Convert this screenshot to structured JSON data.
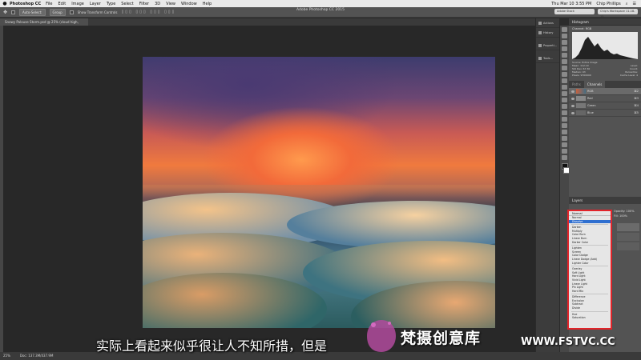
{
  "menubar": {
    "app_name": "Photoshop CC",
    "items": [
      "File",
      "Edit",
      "Image",
      "Layer",
      "Type",
      "Select",
      "Filter",
      "3D",
      "View",
      "Window",
      "Help"
    ],
    "clock": "Thu Mar 10 3:55 PM",
    "user": "Chip Phillips"
  },
  "options_bar": {
    "auto_select": "Auto-Select:",
    "group": "Group",
    "show_transform": "Show Transform Controls",
    "window_title": "Adobe Photoshop CC 2015",
    "search_placeholder": "Adobe Stock",
    "workspace": "Chip's Workspace 11-18-15"
  },
  "document_tab": "Snowy Palouse Storm.psd @ 25% (cloud high, RGB/16) *",
  "dock": {
    "items": [
      "Actions",
      "History",
      "Properti...",
      "Tools..."
    ]
  },
  "histogram": {
    "title": "Histogram",
    "channel_label": "Channel:",
    "channel_value": "RGB",
    "source_label": "Source:",
    "source_value": "Entire Image",
    "mean": "Mean: 112.10",
    "std_dev": "Std Dev: 67.30",
    "median": "Median: 93",
    "pixels": "Pixels: 9700000",
    "level": "Level:",
    "count": "Count:",
    "percentile": "Percentile:",
    "cache": "Cache Level: 4"
  },
  "channels": {
    "tabs": [
      "Paths",
      "Channels"
    ],
    "rows": [
      {
        "name": "RGB",
        "shortcut": "⌘2"
      },
      {
        "name": "Red",
        "shortcut": "⌘3"
      },
      {
        "name": "Green",
        "shortcut": "⌘4"
      },
      {
        "name": "Blue",
        "shortcut": "⌘5"
      }
    ]
  },
  "layers": {
    "title": "Layers",
    "opacity_label": "Opacity:",
    "opacity_value": "100%",
    "fill_label": "Fill:",
    "fill_value": "100%"
  },
  "blend_modes": {
    "current": "Normal",
    "groups": [
      [
        "Normal",
        "Dissolve"
      ],
      [
        "Darken",
        "Multiply",
        "Color Burn",
        "Linear Burn",
        "Darker Color"
      ],
      [
        "Lighten",
        "Screen",
        "Color Dodge",
        "Linear Dodge (Add)",
        "Lighter Color"
      ],
      [
        "Overlay",
        "Soft Light",
        "Hard Light",
        "Vivid Light",
        "Linear Light",
        "Pin Light",
        "Hard Mix"
      ],
      [
        "Difference",
        "Exclusion",
        "Subtract",
        "Divide"
      ],
      [
        "Hue",
        "Saturation"
      ]
    ],
    "selected": "Dissolve"
  },
  "status_bar": {
    "zoom": "25%",
    "doc_info": "Doc: 137.3M/437.9M"
  },
  "overlay": {
    "subtitle": "实际上看起来似乎很让人不知所措，但是",
    "brand": "梵摄创意库",
    "url": "WWW.FSTVC.CC"
  }
}
